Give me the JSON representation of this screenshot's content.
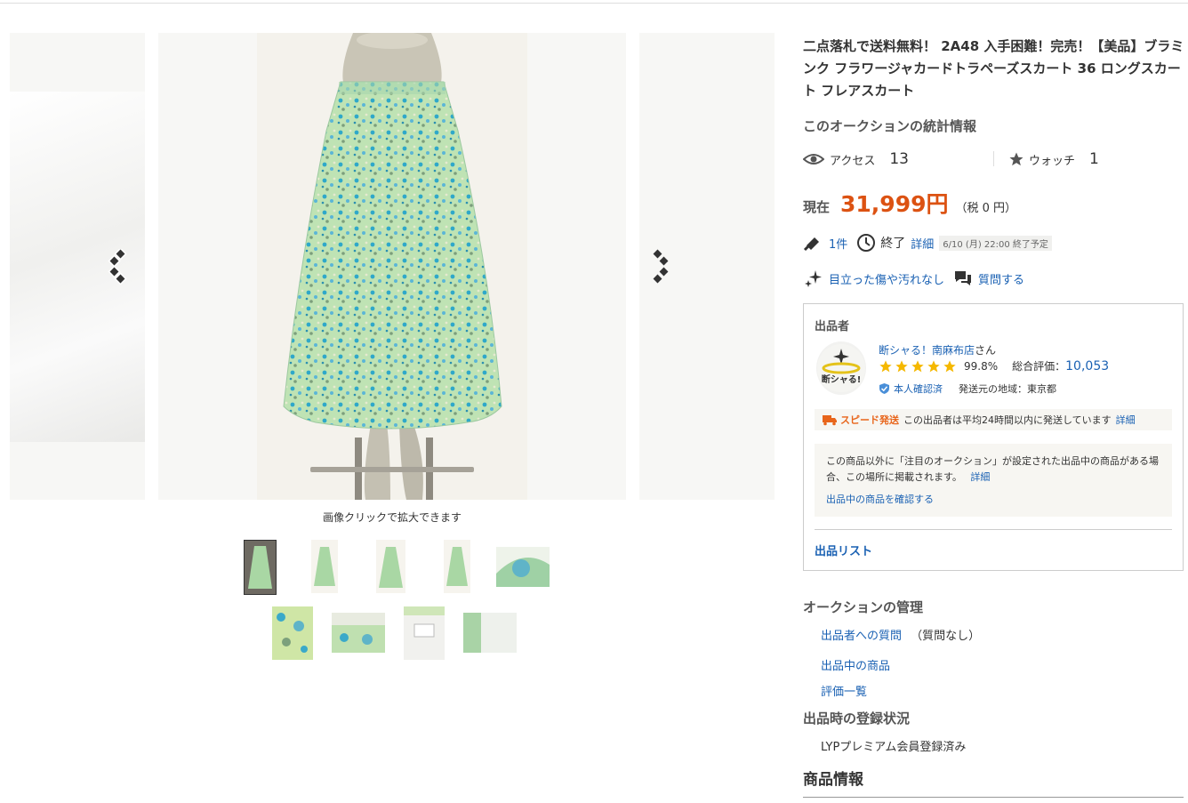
{
  "product": {
    "title": "二点落札で送料無料！ 2A48 入手困難！完売！【美品】ブラミンク フラワージャカードトラペーズスカート 36 ロングスカート フレアスカート"
  },
  "gallery": {
    "caption": "画像クリックで拡大できます",
    "thumbnail_count": 10
  },
  "stats": {
    "heading": "このオークションの統計情報",
    "access_label": "アクセス",
    "access_value": "13",
    "watch_label": "ウォッチ",
    "watch_value": "1"
  },
  "price": {
    "label": "現在",
    "value": "31,999円",
    "tax": "（税 0 円）"
  },
  "bids": {
    "count": "1件",
    "end_label": "終了",
    "detail_link": "詳細",
    "end_time": "6/10 (月) 22:00 終了予定"
  },
  "features": {
    "condition": "目立った傷や汚れなし",
    "question_link": "質問する"
  },
  "seller": {
    "heading": "出品者",
    "name": "断シャる！南麻布店",
    "san": "さん",
    "avatar_text": "断シャる!",
    "good_rate": "99.8%",
    "total_label": "総合評価：",
    "total_value": "10,053",
    "verified": "本人確認済",
    "ship_from": "発送元の地域：東京都",
    "speed_label": "スピード発送",
    "speed_text": "この出品者は平均24時間以内に発送しています",
    "speed_detail": "詳細",
    "notice_text": "この商品以外に「注目のオークション」が設定された出品中の商品がある場合、この場所に掲載されます。",
    "notice_detail": "詳細",
    "notice_link": "出品中の商品を確認する",
    "list_link": "出品リスト"
  },
  "management": {
    "heading": "オークションの管理",
    "question_to_seller": "出品者への質問",
    "question_status": "（質問なし）",
    "items_on_sale": "出品中の商品",
    "ratings": "評価一覧"
  },
  "registration": {
    "heading": "出品時の登録状況",
    "status": "LYPプレミアム会員登録済み"
  },
  "goods_info": {
    "heading": "商品情報"
  },
  "colors": {
    "price": "#dc5212",
    "link": "#1a61b3",
    "speed": "#e8651b",
    "star": "#f5b800"
  },
  "icons": [
    "eye-icon",
    "star-icon",
    "gavel-icon",
    "clock-icon",
    "sparkle-icon",
    "chat-icon",
    "verified-shield-icon",
    "truck-icon",
    "chevron-left-icon",
    "chevron-right-icon"
  ]
}
